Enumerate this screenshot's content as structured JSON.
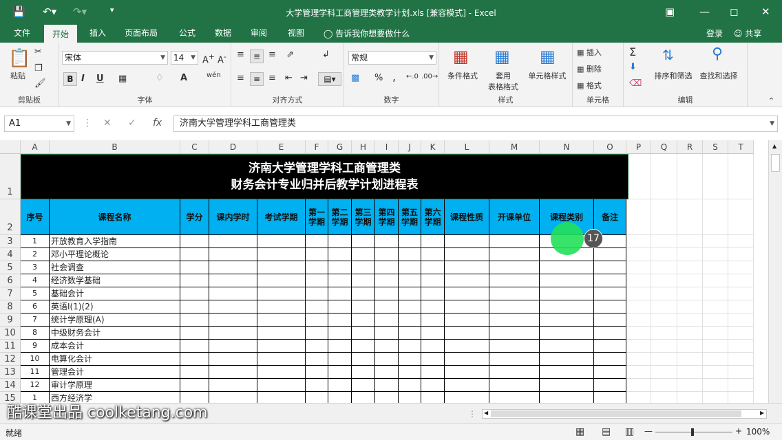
{
  "window": {
    "title": "大学管理学科工商管理类教学计划.xls  [兼容模式] - Excel"
  },
  "ribbon_tabs": [
    "文件",
    "开始",
    "插入",
    "页面布局",
    "公式",
    "数据",
    "审阅",
    "视图"
  ],
  "tell_me": "告诉我你想要做什么",
  "account": {
    "login": "登录",
    "share": "共享"
  },
  "ribbon": {
    "clipboard": {
      "paste": "粘贴",
      "label": "剪贴板"
    },
    "font": {
      "name": "宋体",
      "size": "14",
      "label": "字体",
      "bold": "B",
      "italic": "I",
      "underline": "U",
      "wen": "wén"
    },
    "alignment": {
      "label": "对齐方式"
    },
    "number": {
      "format": "常规",
      "label": "数字",
      "percent": "%",
      "comma": ","
    },
    "styles": {
      "conditional": "条件格式",
      "table1": "套用",
      "table2": "表格格式",
      "cell_styles": "单元格样式",
      "label": "样式"
    },
    "cells": {
      "insert": "插入",
      "delete": "删除",
      "format": "格式",
      "label": "单元格"
    },
    "editing": {
      "sort": "排序和筛选",
      "find": "查找和选择",
      "label": "编辑"
    }
  },
  "formula_bar": {
    "name_box": "A1",
    "formula": "济南大学管理学科工商管理类"
  },
  "columns": [
    "A",
    "B",
    "C",
    "D",
    "E",
    "F",
    "G",
    "H",
    "I",
    "J",
    "K",
    "L",
    "M",
    "N",
    "O",
    "P",
    "Q",
    "R",
    "S",
    "T"
  ],
  "rows": [
    "1",
    "2",
    "3",
    "4",
    "5",
    "6",
    "7",
    "8",
    "9",
    "10",
    "11",
    "12",
    "13",
    "14",
    "15"
  ],
  "sheet": {
    "title_line1": "济南大学管理学科工商管理类",
    "title_line2": "财务会计专业归并后教学计划进程表",
    "headers": [
      "序号",
      "课程名称",
      "学分",
      "课内学时",
      "考试学期",
      "第一学期",
      "第二学期",
      "第三学期",
      "第四学期",
      "第五学期",
      "第六学期",
      "课程性质",
      "开课单位",
      "课程类别",
      "备注"
    ],
    "courses": [
      {
        "no": "1",
        "name": "开放教育入学指南"
      },
      {
        "no": "2",
        "name": "邓小平理论概论"
      },
      {
        "no": "3",
        "name": "社会调查"
      },
      {
        "no": "4",
        "name": "经济数学基础"
      },
      {
        "no": "5",
        "name": "基础会计"
      },
      {
        "no": "6",
        "name": "英语Ⅰ(1)(2)"
      },
      {
        "no": "7",
        "name": "统计学原理(A)"
      },
      {
        "no": "8",
        "name": "中级财务会计"
      },
      {
        "no": "9",
        "name": "成本会计"
      },
      {
        "no": "10",
        "name": "电算化会计"
      },
      {
        "no": "11",
        "name": "管理会计"
      },
      {
        "no": "12",
        "name": "审计学原理"
      },
      {
        "no": "1",
        "name": "西方经济学"
      }
    ]
  },
  "status": {
    "ready": "就绪",
    "zoom": "100%"
  },
  "overlay": {
    "step": "17",
    "watermark": "酷课堂出品 coolketang.com"
  },
  "colors": {
    "accent": "#217346",
    "header_fill": "#00b0f0"
  }
}
